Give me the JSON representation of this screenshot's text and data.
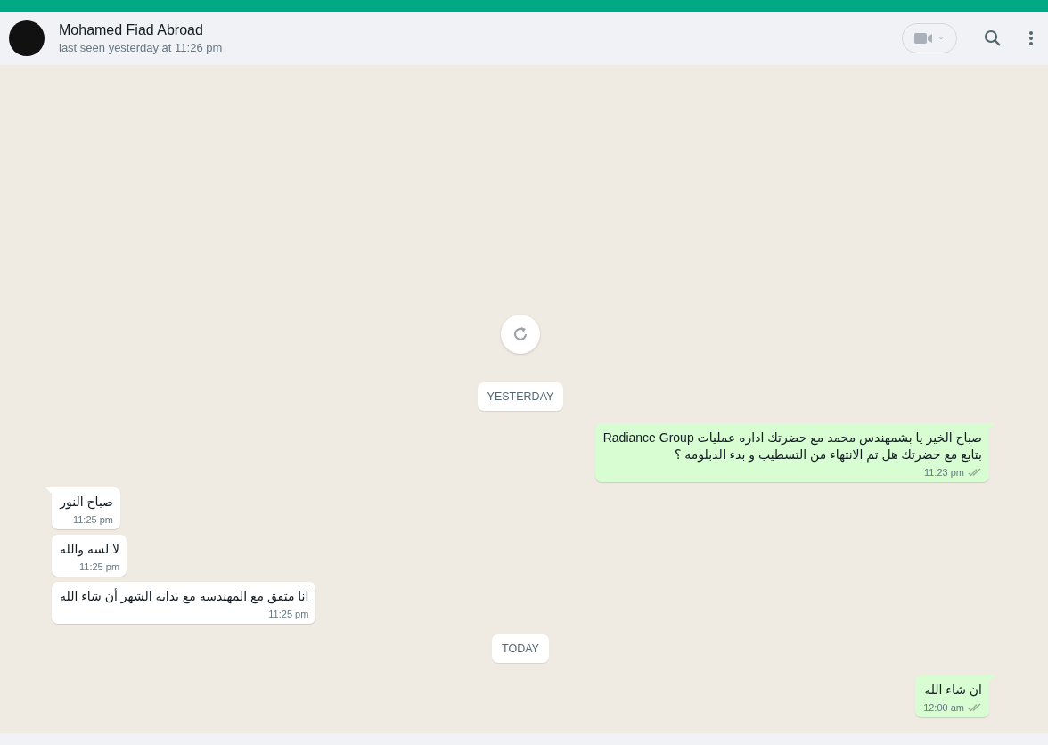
{
  "header": {
    "name": "Mohamed Fiad Abroad",
    "status": "last seen yesterday at 11:26 pm"
  },
  "messages": [
    {
      "kind": "date",
      "text": "YESTERDAY"
    },
    {
      "kind": "out",
      "tail": true,
      "text": "صباح الخير يا بشمهندس محمد مع  حضرتك اداره عمليات Radiance Group\nبتابع مع حضرتك هل تم الانتهاء من التسطيب و بدء الدبلومه ؟",
      "time": "11:23 pm"
    },
    {
      "kind": "in",
      "tail": true,
      "text": "صباح النور",
      "time": "11:25 pm"
    },
    {
      "kind": "in",
      "tail": false,
      "text": "لا لسه والله",
      "time": "11:25 pm"
    },
    {
      "kind": "in",
      "tail": false,
      "text": "انا متفق مع المهندسه مع بدايه الشهر أن شاء الله",
      "time": "11:25 pm"
    },
    {
      "kind": "date",
      "text": "TODAY"
    },
    {
      "kind": "out",
      "tail": true,
      "text": "ان شاء الله",
      "time": "12:00 am"
    }
  ]
}
